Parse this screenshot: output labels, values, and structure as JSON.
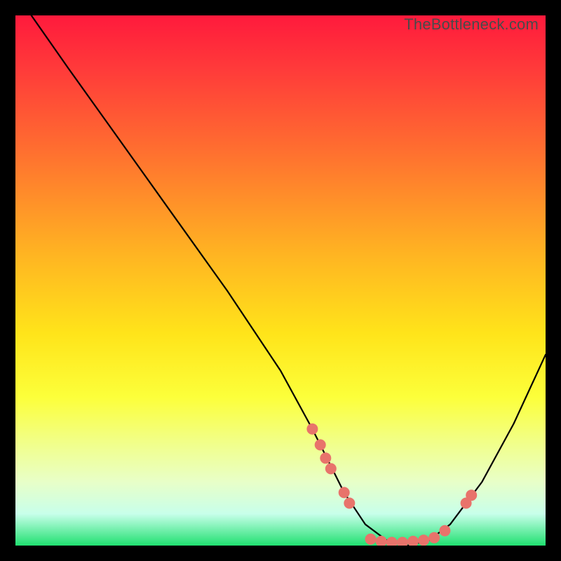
{
  "attribution": "TheBottleneck.com",
  "chart_data": {
    "type": "line",
    "title": "",
    "xlabel": "",
    "ylabel": "",
    "xlim": [
      0,
      100
    ],
    "ylim": [
      0,
      100
    ],
    "series": [
      {
        "name": "bottleneck-curve",
        "x": [
          3,
          10,
          20,
          30,
          40,
          50,
          56,
          62,
          66,
          70,
          74,
          78,
          82,
          88,
          94,
          100
        ],
        "y": [
          100,
          90,
          76,
          62,
          48,
          33,
          22,
          10,
          4,
          1,
          0,
          1,
          4,
          12,
          23,
          36
        ]
      }
    ],
    "markers": {
      "name": "highlight-points",
      "color": "#e8736b",
      "points": [
        {
          "x": 56.0,
          "y": 22.0
        },
        {
          "x": 57.5,
          "y": 19.0
        },
        {
          "x": 58.5,
          "y": 16.5
        },
        {
          "x": 59.5,
          "y": 14.5
        },
        {
          "x": 62.0,
          "y": 10.0
        },
        {
          "x": 63.0,
          "y": 8.0
        },
        {
          "x": 67.0,
          "y": 1.2
        },
        {
          "x": 69.0,
          "y": 0.8
        },
        {
          "x": 71.0,
          "y": 0.6
        },
        {
          "x": 73.0,
          "y": 0.6
        },
        {
          "x": 75.0,
          "y": 0.8
        },
        {
          "x": 77.0,
          "y": 1.0
        },
        {
          "x": 79.0,
          "y": 1.5
        },
        {
          "x": 81.0,
          "y": 2.8
        },
        {
          "x": 85.0,
          "y": 8.0
        },
        {
          "x": 86.0,
          "y": 9.5
        }
      ]
    }
  }
}
